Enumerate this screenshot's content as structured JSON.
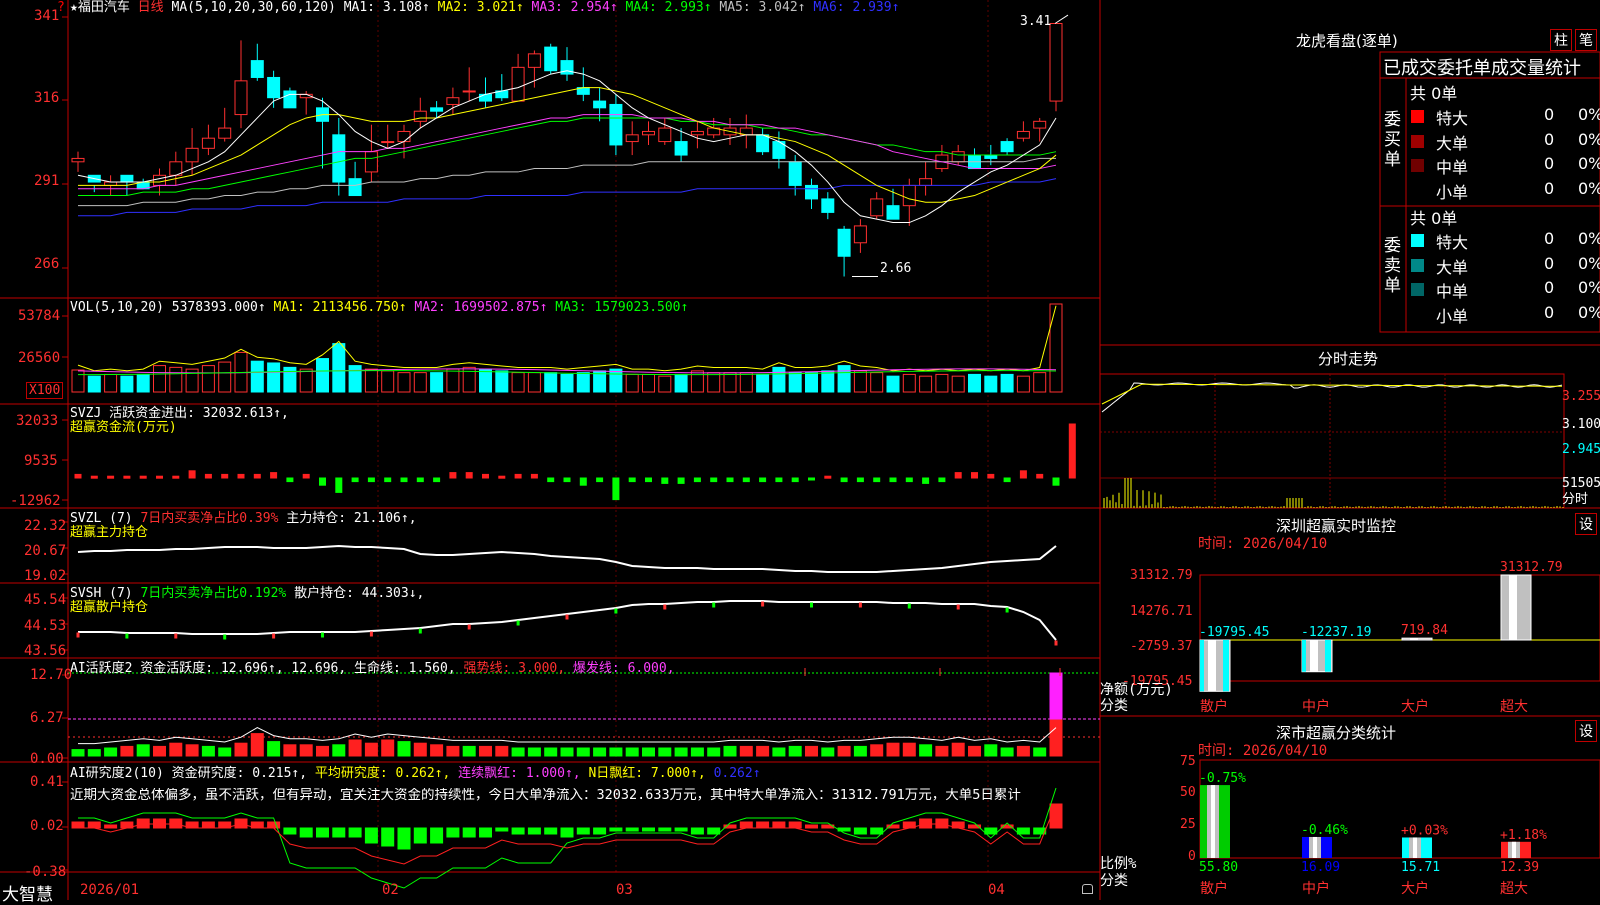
{
  "main": {
    "stock_name": "★福田汽车",
    "period": "日线",
    "ma_header": "MA(5,10,20,30,60,120)",
    "ma": [
      {
        "label": "MA1: 3.108↑",
        "color": "#ffffff"
      },
      {
        "label": "MA2: 3.021↑",
        "color": "#ffff00"
      },
      {
        "label": "MA3: 2.954↑",
        "color": "#ff40ff"
      },
      {
        "label": "MA4: 2.993↑",
        "color": "#00ff00"
      },
      {
        "label": "MA5: 3.042↑",
        "color": "#c0c0c0"
      },
      {
        "label": "MA6: 2.939↑",
        "color": "#3030ff"
      }
    ],
    "y_ticks": [
      "341",
      "316",
      "291",
      "266"
    ],
    "high_mark": "3.41",
    "low_mark": "2.66",
    "flag": "?"
  },
  "vol": {
    "header": "VOL(5,10,20)",
    "value": "5378393.000↑",
    "ma": [
      {
        "label": "MA1: 2113456.750↑",
        "color": "#ffff00"
      },
      {
        "label": "MA2: 1699502.875↑",
        "color": "#ff40ff"
      },
      {
        "label": "MA3: 1579023.500↑",
        "color": "#00ff00"
      }
    ],
    "y_ticks": [
      "53784",
      "26560"
    ],
    "unit": "X100"
  },
  "svzj": {
    "header": "SVZJ  活跃资金进出: 32032.613↑,",
    "sub": "超赢资金流(万元)",
    "y_ticks": [
      "32033",
      "9535",
      "-12962"
    ]
  },
  "svzl": {
    "header_a": "SVZL (7)",
    "header_b": "7日内买卖净占比0.39%",
    "header_c": "主力持仓: 21.106↑,",
    "sub": "超赢主力持仓",
    "y_ticks": [
      "22.32",
      "20.67",
      "19.02"
    ]
  },
  "svsh": {
    "header_a": "SVSH (7)",
    "header_b": "7日内买卖净占比0.192%",
    "header_c": "散户持仓: 44.303↓,",
    "sub": "超赢散户持仓",
    "y_ticks": [
      "45.54",
      "44.53",
      "43.56"
    ]
  },
  "ai1": {
    "header_a": "AI活跃度2 资金活跃度: 12.696↑, 12.696, 生命线: 1.560,",
    "header_b": "强势线: 3.000,",
    "header_c": "爆发线: 6.000,",
    "y_ticks": [
      "12.70",
      "6.27",
      "0.00"
    ]
  },
  "ai2": {
    "header_a": "AI研究度2(10) 资金研究度: 0.215↑,",
    "header_b": "平均研究度: 0.262↑,",
    "header_c": "连续飘红: 1.000↑,",
    "header_d": "N日飘红: 7.000↑,",
    "header_e": "0.262↑",
    "comment": "近期大资金总体偏多，虽不活跃，但有异动，宜关注大资金的持续性，今日大单净流入：32032.633万元，其中特大单净流入：31312.791万元，大单5日累计",
    "y_ticks": [
      "0.41",
      "0.02",
      "-0.38"
    ]
  },
  "xaxis": {
    "brand": "大智慧",
    "labels": [
      "2026/01",
      "02",
      "03",
      "04"
    ]
  },
  "dragon": {
    "title": "龙虎看盘(逐单)",
    "btn1": "柱",
    "btn2": "笔",
    "heading": "已成交委托单成交量统计",
    "buy_label": "委买单",
    "sell_label": "委卖单",
    "buy_total": "共 0单",
    "sell_total": "共 0单",
    "buy_rows": [
      {
        "name": "特大",
        "count": "0",
        "pct": "0%",
        "color": "#ff0000"
      },
      {
        "name": "大单",
        "count": "0",
        "pct": "0%",
        "color": "#a00000"
      },
      {
        "name": "中单",
        "count": "0",
        "pct": "0%",
        "color": "#700000"
      },
      {
        "name": "小单",
        "count": "0",
        "pct": "0%",
        "color": ""
      }
    ],
    "sell_rows": [
      {
        "name": "特大",
        "count": "0",
        "pct": "0%",
        "color": "#00ffff"
      },
      {
        "name": "大单",
        "count": "0",
        "pct": "0%",
        "color": "#008888"
      },
      {
        "name": "中单",
        "count": "0",
        "pct": "0%",
        "color": "#006666"
      },
      {
        "name": "小单",
        "count": "0",
        "pct": "0%",
        "color": ""
      }
    ]
  },
  "intraday": {
    "title": "分时走势",
    "y_ticks": [
      "3.255",
      "3.100",
      "2.945"
    ],
    "vol_tick": "51505",
    "vol_unit": "分时"
  },
  "monitor": {
    "title": "深圳超赢实时监控",
    "btn": "设",
    "date": "时间: 2026/04/10",
    "y_ticks": [
      "31312.79",
      "14276.71",
      "-2759.37",
      "-19795.45"
    ],
    "axis_note": "净额(万元)",
    "axis_note2": "分类",
    "categories": [
      "散户",
      "中户",
      "大户",
      "超大"
    ],
    "values": [
      "-19795.45",
      "-12237.19",
      "719.84",
      "31312.79"
    ]
  },
  "classify": {
    "title": "深市超赢分类统计",
    "btn": "设",
    "date": "时间: 2026/04/10",
    "y_ticks": [
      "75",
      "50",
      "25",
      "0"
    ],
    "axis_note": "比例%",
    "axis_note2": "分类",
    "categories": [
      "散户",
      "中户",
      "大户",
      "超大"
    ],
    "changes": [
      "-0.75%",
      "-0.46%",
      "+0.03%",
      "+1.18%"
    ],
    "values": [
      "55.80",
      "16.09",
      "15.71",
      "12.39"
    ]
  }
}
